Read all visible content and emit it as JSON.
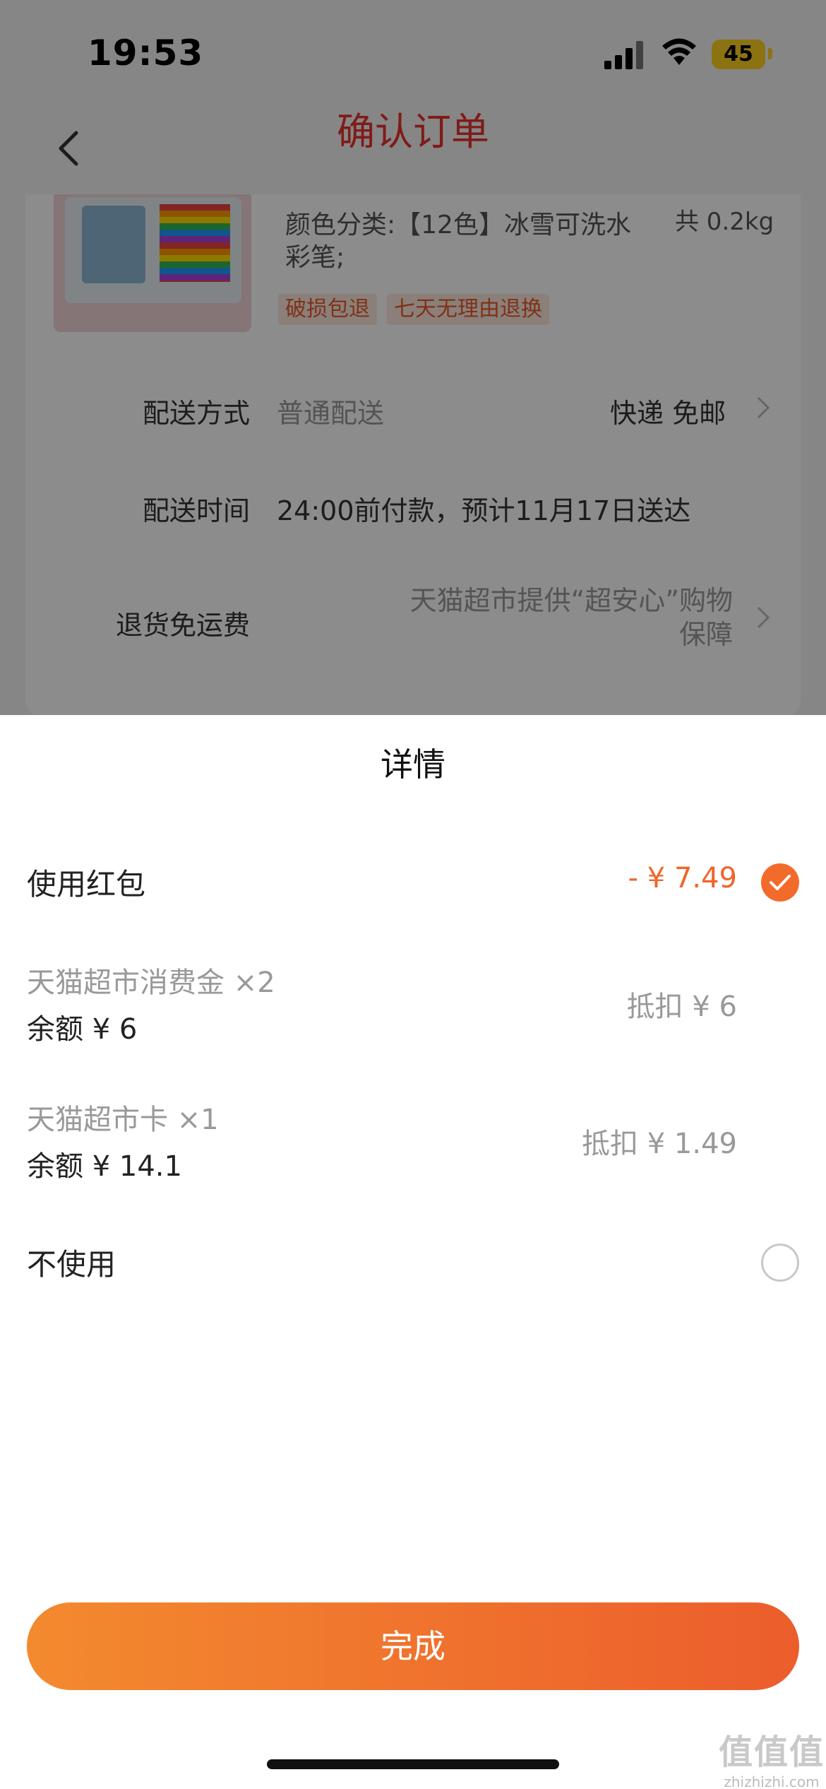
{
  "status_bar": {
    "time": "19:53",
    "battery": "45"
  },
  "nav": {
    "title": "确认订单"
  },
  "product": {
    "spec": "颜色分类:【12色】冰雪可洗水彩笔;",
    "weight": "共 0.2kg",
    "tags": [
      "破损包退",
      "七天无理由退换"
    ]
  },
  "delivery": {
    "method_label": "配送方式",
    "method_value": "普通配送",
    "method_right": "快递 免邮",
    "time_label": "配送时间",
    "time_value": "24:00前付款，预计11月17日送达",
    "return_label": "退货免运费",
    "return_value_line1": "天猫超市提供“超安心”购物",
    "return_value_line2": "保障"
  },
  "sheet": {
    "title": "详情",
    "use_redpacket_label": "使用红包",
    "use_redpacket_amount": "- ¥ 7.49",
    "items": [
      {
        "name": "天猫超市消费金 ×2",
        "balance": "余额 ¥ 6",
        "deduct": "抵扣 ¥ 6"
      },
      {
        "name": "天猫超市卡 ×1",
        "balance": "余额 ¥ 14.1",
        "deduct": "抵扣 ¥ 1.49"
      }
    ],
    "no_use_label": "不使用",
    "done_label": "完成"
  },
  "watermark": {
    "logo": "值值值",
    "url": "zhizhizhi.com"
  },
  "colors": {
    "accent": "#f26b2b",
    "title_red": "#e8322d"
  }
}
